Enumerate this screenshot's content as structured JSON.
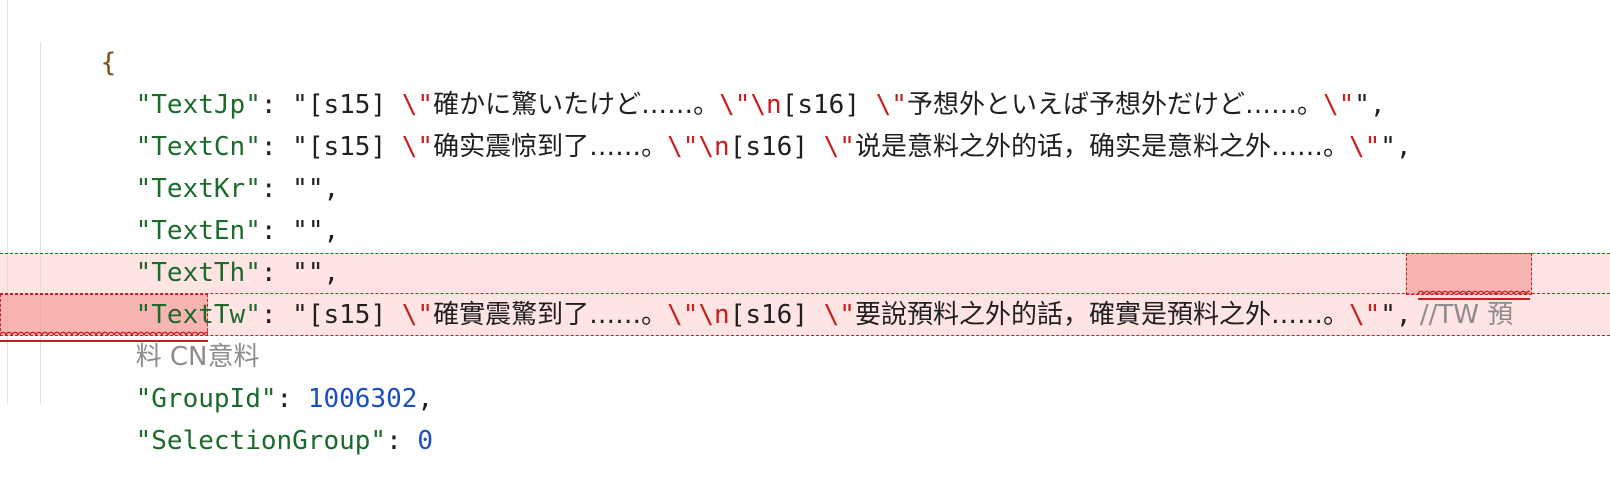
{
  "editor": {
    "open_brace": "{",
    "lines": [
      {
        "key": "\"TextJp\"",
        "sep": ": ",
        "segments": [
          "\"[s15] ",
          "\\\"",
          "確かに驚いたけど……。",
          "\\\"",
          "\\n",
          "[s16] ",
          "\\\"",
          "予想外といえば予想外だけど……。",
          "\\\"",
          "\"",
          ","
        ]
      },
      {
        "key": "\"TextCn\"",
        "sep": ": ",
        "segments": [
          "\"[s15] ",
          "\\\"",
          "确实震惊到了……。",
          "\\\"",
          "\\n",
          "[s16] ",
          "\\\"",
          "说是意料之外的话，确实是意料之外……。",
          "\\\"",
          "\"",
          ","
        ]
      },
      {
        "key": "\"TextKr\"",
        "sep": ": ",
        "value": "\"\"",
        "comma": ","
      },
      {
        "key": "\"TextEn\"",
        "sep": ": ",
        "value": "\"\"",
        "comma": ","
      },
      {
        "key": "\"TextTh\"",
        "sep": ": ",
        "value": "\"\"",
        "comma": ","
      },
      {
        "key": "\"TextTw\"",
        "sep": ": ",
        "segments": [
          "\"[s15] ",
          "\\\"",
          "確實震驚到了……。",
          "\\\"",
          "\\n",
          "[s16] ",
          "\\\"",
          "要說預料之外的話，確實是預料之外……。",
          "\\\"",
          "\"",
          ","
        ],
        "comment_part1": " //TW 預",
        "comment_part2": "料 CN意料"
      },
      {
        "key": "\"GroupId\"",
        "sep": ": ",
        "number": "1006302",
        "comma": ","
      },
      {
        "key": "\"SelectionGroup\"",
        "sep": ": ",
        "number": "0"
      }
    ]
  },
  "colors": {
    "key": "#1b6b2a",
    "escape": "#c81e1e",
    "number": "#1a4fc1",
    "comment": "#8c8c8c",
    "brace": "#7a4b12",
    "error_band": "#ffd6d6"
  }
}
